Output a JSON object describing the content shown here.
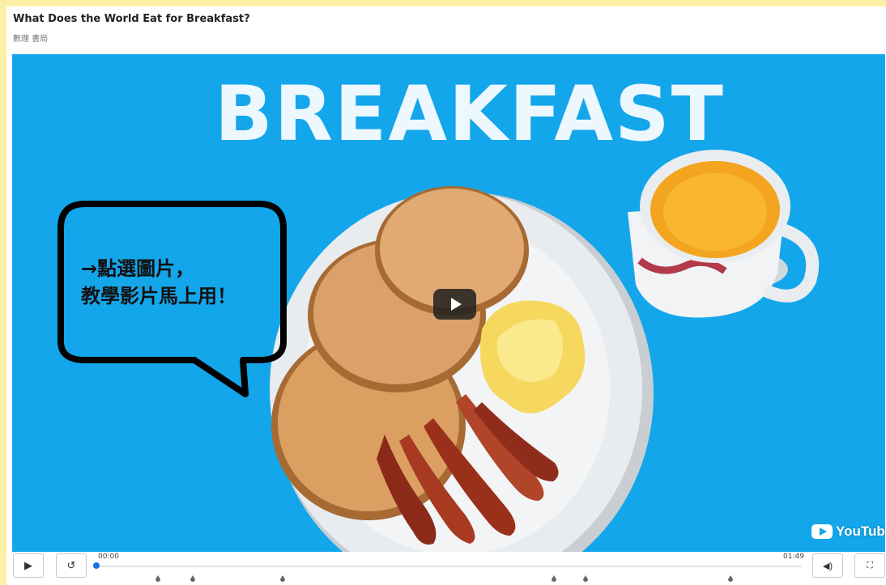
{
  "page": {
    "title": "What Does the World Eat for Breakfast?",
    "subtitle": "數理 書局"
  },
  "video": {
    "overlay_heading": "BREAKFAST",
    "callout_line1": "→點選圖片，",
    "callout_line2": "教學影片馬上用！",
    "platform_logo": "YouTube",
    "background_color": "#14a6ea"
  },
  "controls": {
    "play_icon": "play-icon",
    "replay_icon": "replay-icon",
    "current_time": "00:00",
    "duration": "01:49",
    "progress_fraction": 0,
    "volume_icon": "volume-icon",
    "fullscreen_icon": "fullscreen-icon",
    "accent_color": "#1b72e8"
  }
}
